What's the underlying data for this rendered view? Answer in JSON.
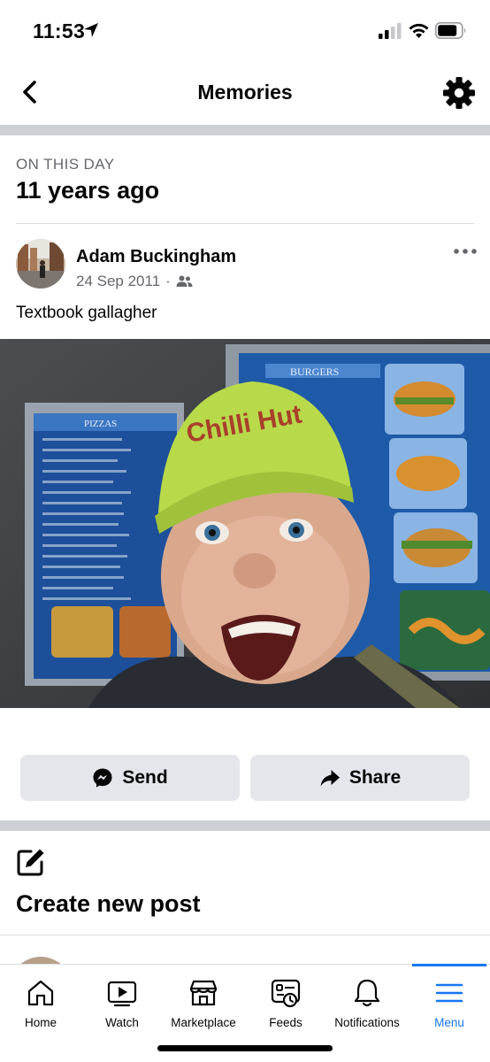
{
  "status_bar": {
    "time": "11:53"
  },
  "nav": {
    "title": "Memories"
  },
  "memory": {
    "section_label": "ON THIS DAY",
    "years_ago": "11 years ago",
    "post": {
      "author": "Adam Buckingham",
      "date": "24 Sep 2011",
      "separator": "·",
      "audience_icon": "friends-icon",
      "text": "Textbook gallagher",
      "photo": {
        "cap_text": "Chilli Hut",
        "menu_left_title": "PIZZAS",
        "menu_right_title": "BURGERS"
      }
    },
    "actions": {
      "send_label": "Send",
      "share_label": "Share"
    }
  },
  "create_post": {
    "label": "Create new post"
  },
  "tabs": [
    {
      "label": "Home",
      "icon": "home-icon"
    },
    {
      "label": "Watch",
      "icon": "video-icon"
    },
    {
      "label": "Marketplace",
      "icon": "shop-icon"
    },
    {
      "label": "Feeds",
      "icon": "feeds-icon"
    },
    {
      "label": "Notifications",
      "icon": "bell-icon"
    },
    {
      "label": "Menu",
      "icon": "menu-icon",
      "active": true
    }
  ],
  "colors": {
    "accent": "#1877f2",
    "secondary_text": "#65676b",
    "button_bg": "#e4e6eb",
    "divider": "#cdd0d4"
  }
}
